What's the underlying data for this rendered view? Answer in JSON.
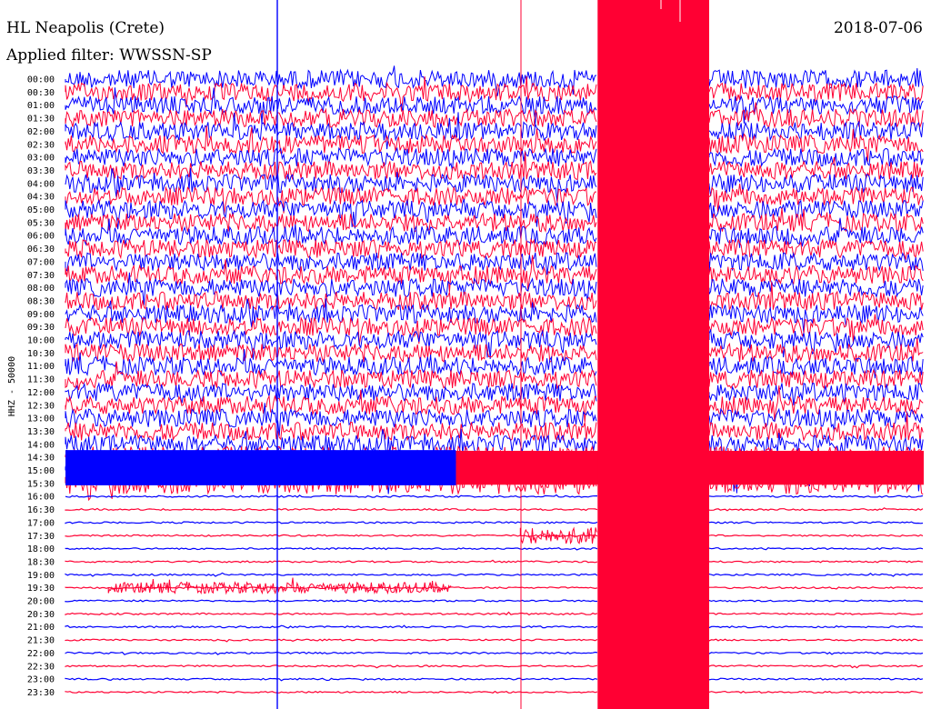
{
  "header": {
    "station": "HL Neapolis (Crete)",
    "filter": "Applied filter: WWSSN-SP",
    "date": "2018-07-06"
  },
  "colors": {
    "trace_a": "#0000ff",
    "trace_b": "#ff0033",
    "background": "#ffffff"
  },
  "chart_data": {
    "type": "line",
    "chart_kind": "helicorder seismogram",
    "title": "HL Neapolis (Crete)",
    "subtitle": "Applied filter: WWSSN-SP",
    "date": "2018-07-06",
    "ylabel": "HHZ - 50000",
    "minutes_per_line": 30,
    "grid": false,
    "series_colors": [
      "#0000ff",
      "#ff0033"
    ],
    "hour_labels": [
      "00:00",
      "00:30",
      "01:00",
      "01:30",
      "02:00",
      "02:30",
      "03:00",
      "03:30",
      "04:00",
      "04:30",
      "05:00",
      "05:30",
      "06:00",
      "06:30",
      "07:00",
      "07:30",
      "08:00",
      "08:30",
      "09:00",
      "09:30",
      "10:00",
      "10:30",
      "11:00",
      "11:30",
      "12:00",
      "12:30",
      "13:00",
      "13:30",
      "14:00",
      "14:30",
      "15:00",
      "15:30",
      "16:00",
      "16:30",
      "17:00",
      "17:30",
      "18:00",
      "18:30",
      "19:00",
      "19:30",
      "20:00",
      "20:30",
      "21:00",
      "21:30",
      "22:00",
      "22:30",
      "23:00",
      "23:30"
    ],
    "noisy_until_line": 32,
    "gap_fraction": [
      0.62,
      0.75
    ],
    "events": [
      {
        "line": "19:30",
        "from_fraction": 0.05,
        "to_fraction": 0.45
      },
      {
        "line": "17:30",
        "from_fraction": 0.53,
        "to_fraction": 0.62
      }
    ]
  }
}
